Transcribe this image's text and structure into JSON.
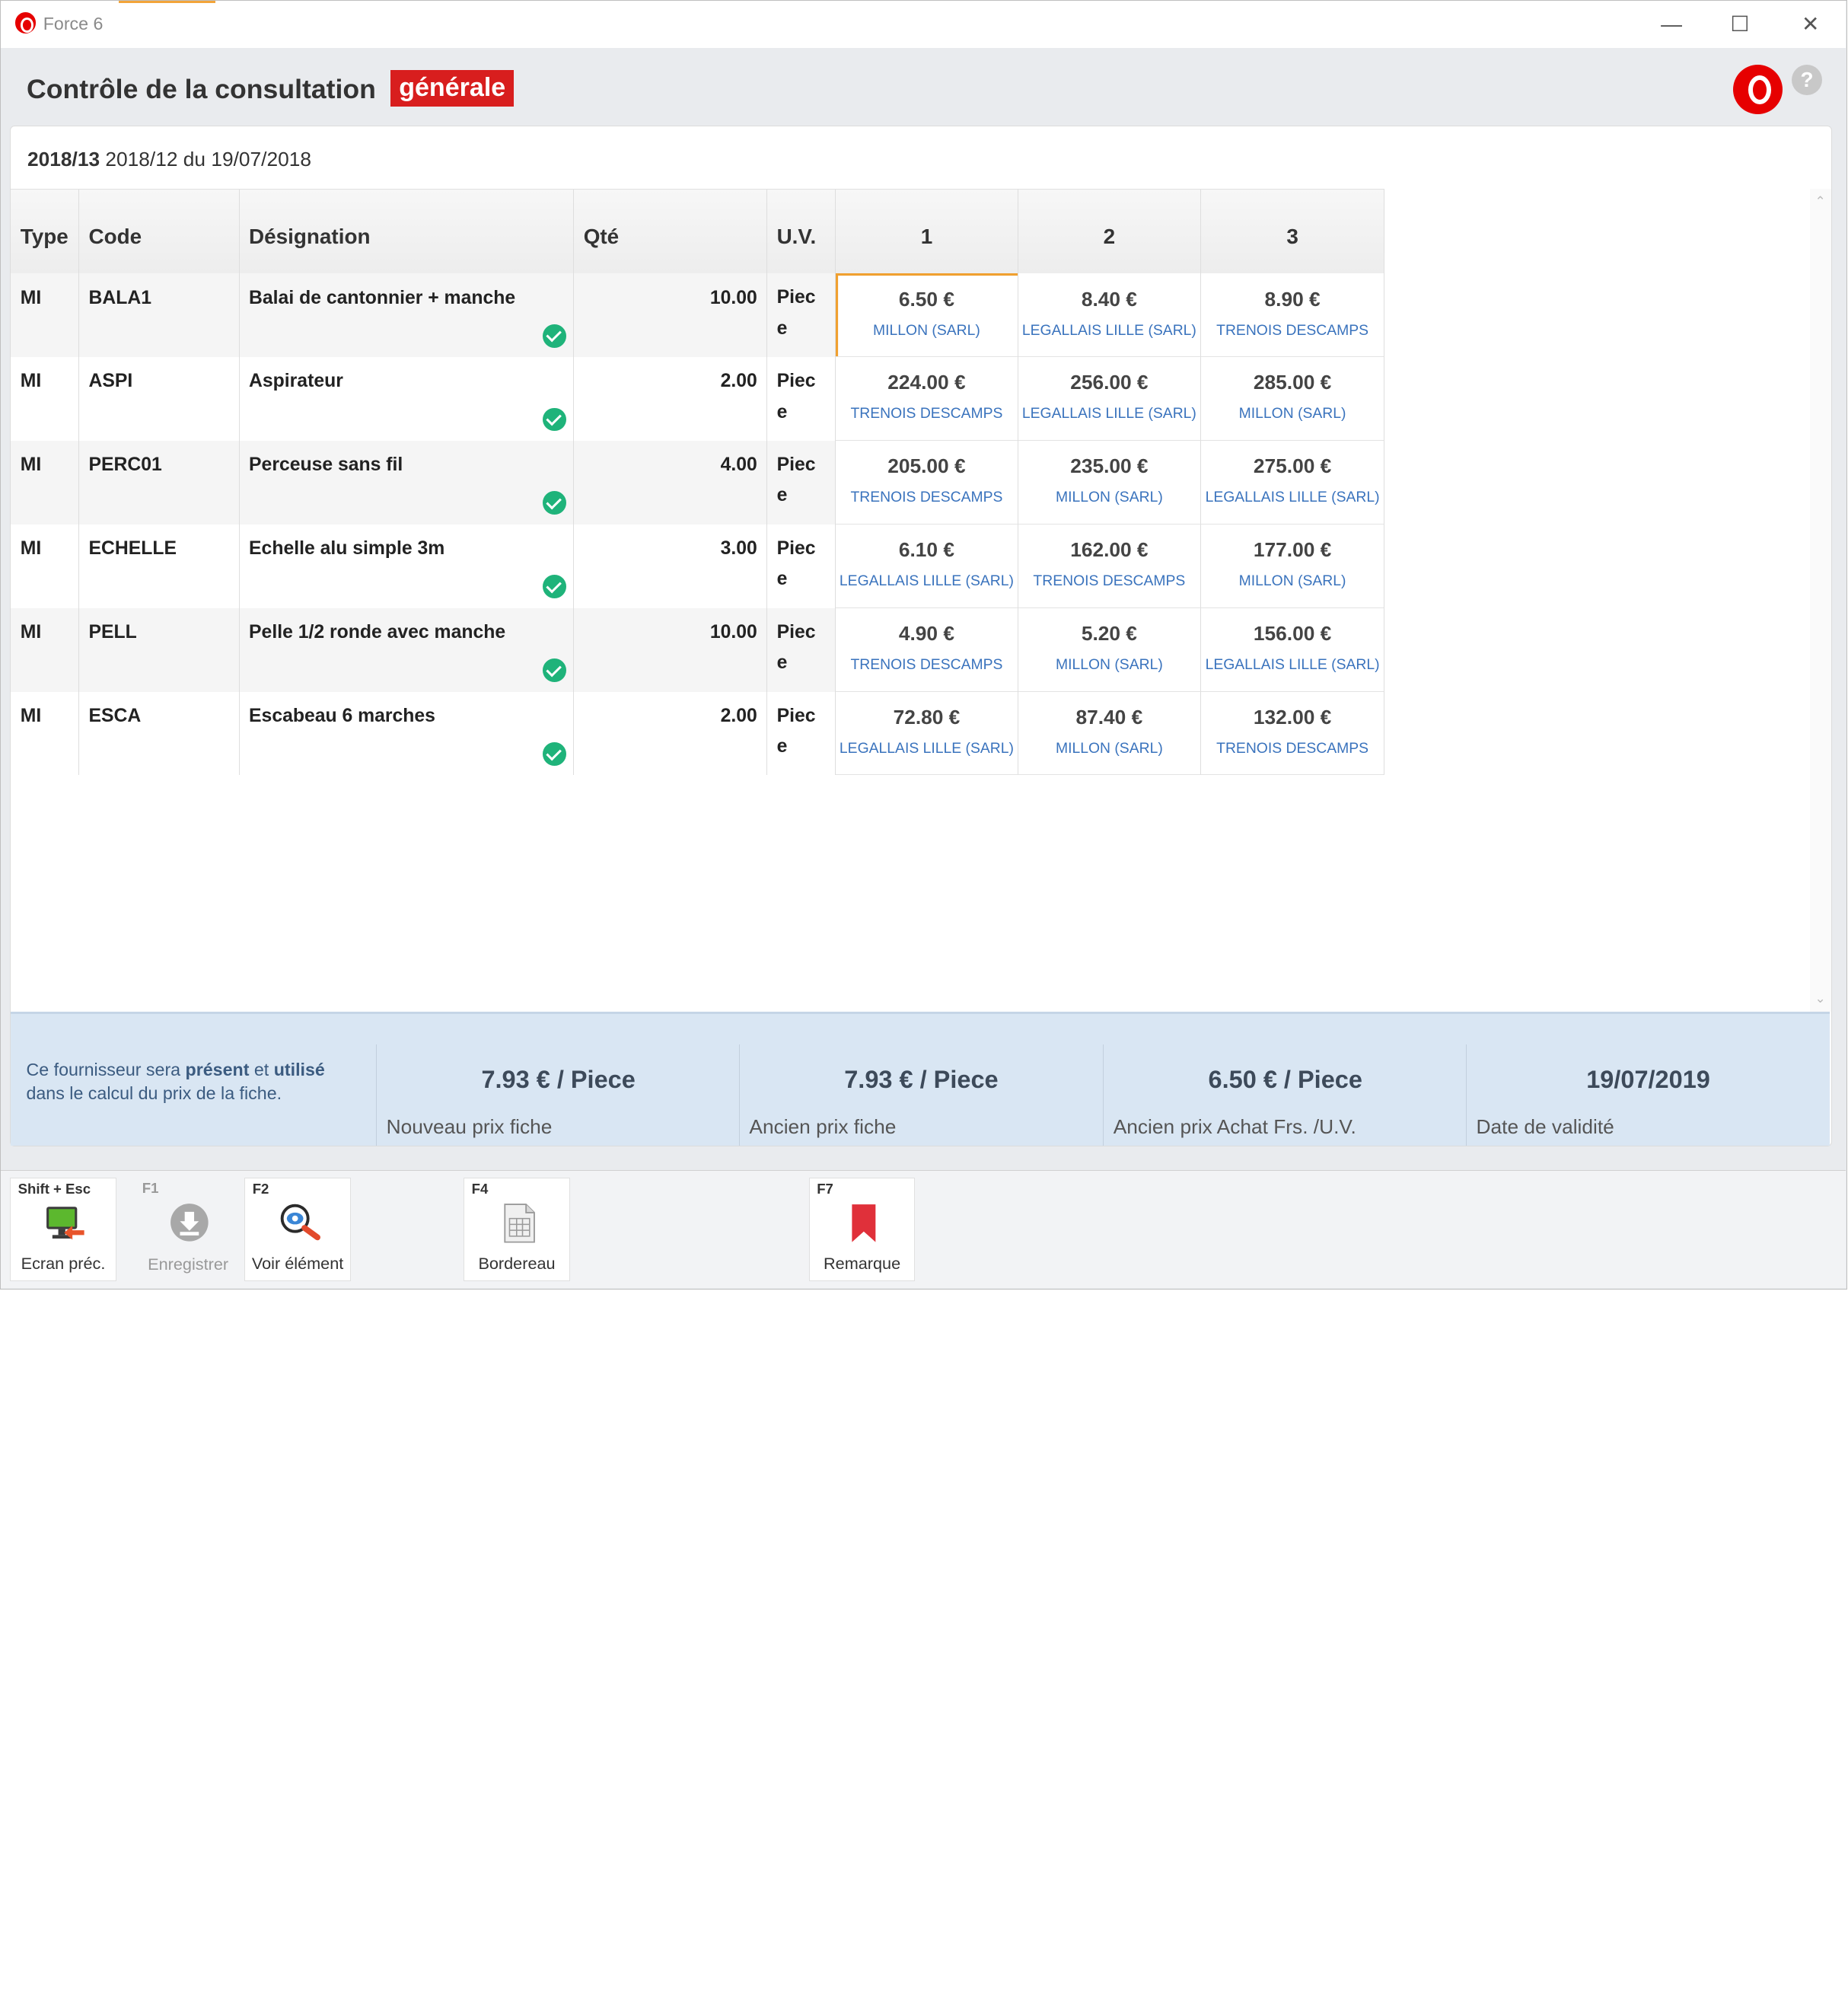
{
  "window": {
    "title": "Force 6",
    "minimize": "—",
    "maximize": "☐",
    "close": "✕"
  },
  "header": {
    "title": "Contrôle de la consultation",
    "badge": "générale",
    "help": "?"
  },
  "reference": {
    "bold": "2018/13",
    "rest": " 2018/12 du 19/07/2018"
  },
  "columns": [
    "Type",
    "Code",
    "Désignation",
    "Qté",
    "U.V.",
    "1",
    "2",
    "3"
  ],
  "rows": [
    {
      "type": "MI",
      "code": "BALA1",
      "designation": "Balai de cantonnier + manche",
      "qty": "10.00",
      "uv1": "Piec",
      "uv2": "e",
      "offers": [
        {
          "price": "6.50 €",
          "supplier": "MILLON (SARL)"
        },
        {
          "price": "8.40 €",
          "supplier": "LEGALLAIS LILLE (SARL)"
        },
        {
          "price": "8.90 €",
          "supplier": "TRENOIS DESCAMPS"
        }
      ]
    },
    {
      "type": "MI",
      "code": "ASPI",
      "designation": "Aspirateur",
      "qty": "2.00",
      "uv1": "Piec",
      "uv2": "e",
      "offers": [
        {
          "price": "224.00 €",
          "supplier": "TRENOIS DESCAMPS"
        },
        {
          "price": "256.00 €",
          "supplier": "LEGALLAIS LILLE (SARL)"
        },
        {
          "price": "285.00 €",
          "supplier": "MILLON (SARL)"
        }
      ]
    },
    {
      "type": "MI",
      "code": "PERC01",
      "designation": "Perceuse sans fil",
      "qty": "4.00",
      "uv1": "Piec",
      "uv2": "e",
      "offers": [
        {
          "price": "205.00 €",
          "supplier": "TRENOIS DESCAMPS"
        },
        {
          "price": "235.00 €",
          "supplier": "MILLON (SARL)"
        },
        {
          "price": "275.00 €",
          "supplier": "LEGALLAIS LILLE (SARL)"
        }
      ]
    },
    {
      "type": "MI",
      "code": "ECHELLE",
      "designation": "Echelle alu simple 3m",
      "qty": "3.00",
      "uv1": "Piec",
      "uv2": "e",
      "offers": [
        {
          "price": "6.10 €",
          "supplier": "LEGALLAIS LILLE (SARL)"
        },
        {
          "price": "162.00 €",
          "supplier": "TRENOIS DESCAMPS"
        },
        {
          "price": "177.00 €",
          "supplier": "MILLON (SARL)"
        }
      ]
    },
    {
      "type": "MI",
      "code": "PELL",
      "designation": "Pelle 1/2 ronde avec manche",
      "qty": "10.00",
      "uv1": "Piec",
      "uv2": "e",
      "offers": [
        {
          "price": "4.90 €",
          "supplier": "TRENOIS DESCAMPS"
        },
        {
          "price": "5.20 €",
          "supplier": "MILLON (SARL)"
        },
        {
          "price": "156.00 €",
          "supplier": "LEGALLAIS LILLE (SARL)"
        }
      ]
    },
    {
      "type": "MI",
      "code": "ESCA",
      "designation": "Escabeau 6 marches",
      "qty": "2.00",
      "uv1": "Piec",
      "uv2": "e",
      "offers": [
        {
          "price": "72.80 €",
          "supplier": "LEGALLAIS LILLE (SARL)"
        },
        {
          "price": "87.40 €",
          "supplier": "MILLON (SARL)"
        },
        {
          "price": "132.00 €",
          "supplier": "TRENOIS DESCAMPS"
        }
      ]
    }
  ],
  "summary": {
    "info_a": "Ce fournisseur sera ",
    "info_b": "présent",
    "info_c": " et ",
    "info_d": "utilisé",
    "info_e": "dans le calcul du prix de la fiche.",
    "cols": [
      {
        "value": "7.93 € / Piece",
        "label": "Nouveau prix fiche"
      },
      {
        "value": "7.93 € / Piece",
        "label": "Ancien prix fiche"
      },
      {
        "value": "6.50 € / Piece",
        "label": "Ancien prix Achat Frs. /U.V."
      },
      {
        "value": "19/07/2019",
        "label": "Date de validité"
      }
    ]
  },
  "toolbar": [
    {
      "key": "Shift + Esc",
      "label": "Ecran préc.",
      "icon": "screen-back-icon"
    },
    {
      "key": "F1",
      "label": "Enregistrer",
      "icon": "save-download-icon"
    },
    {
      "key": "F2",
      "label": "Voir élément",
      "icon": "eye-magnifier-icon"
    },
    {
      "key": "F4",
      "label": "Bordereau",
      "icon": "spreadsheet-icon"
    },
    {
      "key": "F7",
      "label": "Remarque",
      "icon": "bookmark-icon"
    }
  ],
  "colors": {
    "accent_red": "#d81e1e",
    "check_green": "#1fb37a",
    "supplier_blue": "#3a73bd",
    "selection": "#f0a030"
  }
}
